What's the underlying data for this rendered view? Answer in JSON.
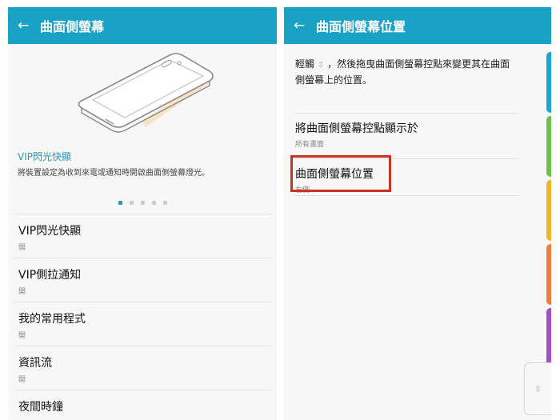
{
  "left": {
    "title": "曲面側螢幕",
    "feature_title": "VIP閃光快顯",
    "feature_desc": "將裝置設定為收到來電或通知時開啟曲面側螢幕燈光。",
    "page_dots": {
      "total": 5,
      "active": 1
    },
    "items": [
      {
        "label": "VIP閃光快顯",
        "sub": "開"
      },
      {
        "label": "VIP側拉通知",
        "sub": "開"
      },
      {
        "label": "我的常用程式",
        "sub": "開"
      },
      {
        "label": "資訊流",
        "sub": "開"
      },
      {
        "label": "夜間時鐘",
        "sub": ""
      }
    ]
  },
  "right": {
    "title": "曲面側螢幕位置",
    "desc_before": "輕觸",
    "desc_icon": "⇳",
    "desc_after": "，然後拖曳曲面側螢幕控點來變更其在曲面側螢幕上的位置。",
    "items": [
      {
        "label": "將曲面側螢幕控點顯示於",
        "sub": "所有畫面"
      },
      {
        "label": "曲面側螢幕位置",
        "sub": "右側"
      }
    ],
    "handle_icon": "⇳"
  },
  "colors": {
    "appbar": "#19a1c6",
    "accent": "#2f93b3",
    "highlight": "#c9331f",
    "edge_tabs": [
      "#1ba7d6",
      "#6cc34a",
      "#f4b42a",
      "#f07d3c",
      "#a54fc4"
    ]
  }
}
